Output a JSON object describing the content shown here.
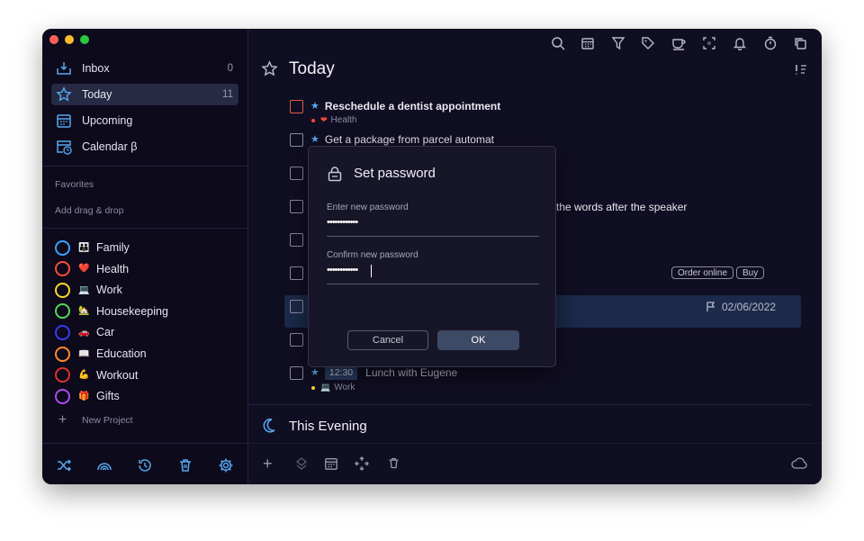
{
  "sidebar": {
    "nav": [
      {
        "label": "Inbox",
        "count": "0",
        "icon": "inbox-icon"
      },
      {
        "label": "Today",
        "count": "11",
        "icon": "star-icon"
      },
      {
        "label": "Upcoming",
        "count": "",
        "icon": "calendar-icon"
      },
      {
        "label": "Calendar β",
        "count": "",
        "icon": "calendar-clock-icon"
      }
    ],
    "favorites_label": "Favorites",
    "add_drag_drop": "Add drag & drop",
    "projects": [
      {
        "name": "Family",
        "emoji": "👪",
        "ring": "#3aa0ff"
      },
      {
        "name": "Health",
        "emoji": "❤️",
        "ring": "#ff4a3a"
      },
      {
        "name": "Work",
        "emoji": "💻",
        "ring": "#ffd52a"
      },
      {
        "name": "Housekeeping",
        "emoji": "🏡",
        "ring": "#55d655"
      },
      {
        "name": "Car",
        "emoji": "🚗",
        "ring": "#3a3af0"
      },
      {
        "name": "Education",
        "emoji": "📖",
        "ring": "#ff8a2a"
      },
      {
        "name": "Workout",
        "emoji": "💪",
        "ring": "#e0302a"
      },
      {
        "name": "Gifts",
        "emoji": "🎁",
        "ring": "#b048f0"
      }
    ],
    "new_project": "New Project",
    "bottom_icons": [
      "shuffle-icon",
      "rainbow-icon",
      "history-icon",
      "trash-icon",
      "settings-icon"
    ]
  },
  "main": {
    "title": "Today",
    "top_icons": [
      "search-icon",
      "calendar-icon",
      "filter-icon",
      "tag-icon",
      "coffee-icon",
      "focus-icon",
      "bell-icon",
      "timer-icon",
      "copy-icon"
    ],
    "tasks": [
      {
        "title": "Reschedule a dentist appointment",
        "sub": "Health"
      },
      {
        "title": "Get a package from parcel automat"
      },
      {
        "title": "the words after the speaker"
      },
      {
        "date": "02/06/2022"
      },
      {
        "time": "12:30",
        "title": "Lunch with Eugene",
        "sub": "Work"
      }
    ],
    "chips": [
      "Order online",
      "Buy"
    ],
    "evening": "This Evening"
  },
  "modal": {
    "title": "Set password",
    "label1": "Enter new password",
    "value1": "••••••••••••",
    "label2": "Confirm new password",
    "value2": "••••••••••••",
    "cancel": "Cancel",
    "ok": "OK"
  },
  "colors": {
    "accent": "#58a8f0",
    "window": "#0e0c1e",
    "modal": "#171628"
  }
}
